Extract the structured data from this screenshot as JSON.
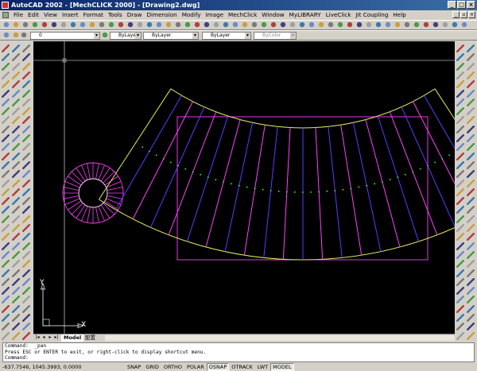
{
  "window": {
    "title": "AutoCAD 2002 - [MechCLICK 2000] - [Drawing2.dwg]"
  },
  "menu": {
    "items": [
      "File",
      "Edit",
      "View",
      "Insert",
      "Format",
      "Tools",
      "Draw",
      "Dimension",
      "Modify",
      "Image",
      "MechClick",
      "Window",
      "MyLIBRARY",
      "LiveClick",
      "Jit Coupling",
      "Help"
    ]
  },
  "properties": {
    "layer": "0",
    "color": "ByLayer",
    "linetype": "ByLayer",
    "lineweight": "ByLayer",
    "plotstyle": "ByColor"
  },
  "canvas": {
    "ucs_y_label": "Y",
    "ucs_x_label": "X",
    "colors": {
      "background": "#000000",
      "magenta": "#ff40ff",
      "blue": "#5a3cff",
      "yellow": "#e0f060",
      "green": "#40ff40",
      "white": "#ffffff"
    }
  },
  "layout_tabs": {
    "model": "Model",
    "layout1": "配置"
  },
  "command": {
    "line1": "Command:  _pan",
    "line2": "Press ESC or ENTER to exit, or right-click to display shortcut menu.",
    "line3": "Command:"
  },
  "status": {
    "coords": "-637.7546, 1045.3993, 0.0000",
    "toggles": [
      "SNAP",
      "GRID",
      "ORTHO",
      "POLAR",
      "OSNAP",
      "OTRACK",
      "LWT",
      "MODEL"
    ]
  }
}
